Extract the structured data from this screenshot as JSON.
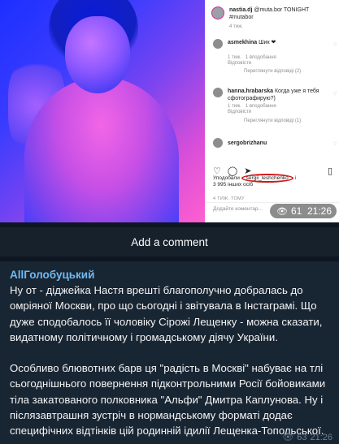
{
  "media": {
    "instagram": {
      "post_header_user": "nastia.dj",
      "post_header_text": "@muta.bor TONIGHT #mutabor",
      "post_age": "4 тиж.",
      "comments": [
        {
          "user": "asmekhina",
          "text": "Шик ❤",
          "time": "1 тиж.",
          "likes": "1 вподобання",
          "reply": "Відповісти",
          "replies": "Переглянути відповіді (2)"
        },
        {
          "user": "hanna.hrabarska",
          "text": "Когда уже я тебя сфотографирую?)",
          "time": "1 тиж.",
          "likes": "1 вподобання",
          "reply": "Відповісти",
          "replies": "Переглянути відповіді (1)"
        },
        {
          "user": "sergobrizhanu",
          "text": "",
          "time": "",
          "likes": "",
          "reply": "",
          "replies": ""
        }
      ],
      "likes_prefix": "Уподобали",
      "liker": "sergii_leshchenko",
      "likes_suffix": "і",
      "likes_count": "3 995 інших осіб",
      "timestamp": "4 ТИЖ. ТОМУ",
      "add_comment_placeholder": "Додайте коментар..."
    },
    "views": "61",
    "time": "21:26"
  },
  "comment_bar": {
    "label": "Add a comment"
  },
  "post": {
    "author": "AllГолобуцький",
    "paragraph1": "Ну от - діджейка Настя врешті благополучно добралась до омріяної Москви, про що сьогодні і звітувала в Інстаграмі. Що дуже сподобалось її чоловіку Сірожі Лещенку - можна сказати, видатному політичному і громадському діячу України.",
    "paragraph2": "Особливо блювотних барв ця \"радість в Москві\" набуває на тлі сьогоднішнього повернення підконтрольними Росії бойовиками тіла закатованого полковника \"Альфи\" Дмитра Каплунова. Ну і післязавтрашня зустріч в нормандському форматі додає специфічних відтінків цій родинній ідилії Лещенка-Топольської.",
    "views": "63",
    "time": "21:26"
  }
}
